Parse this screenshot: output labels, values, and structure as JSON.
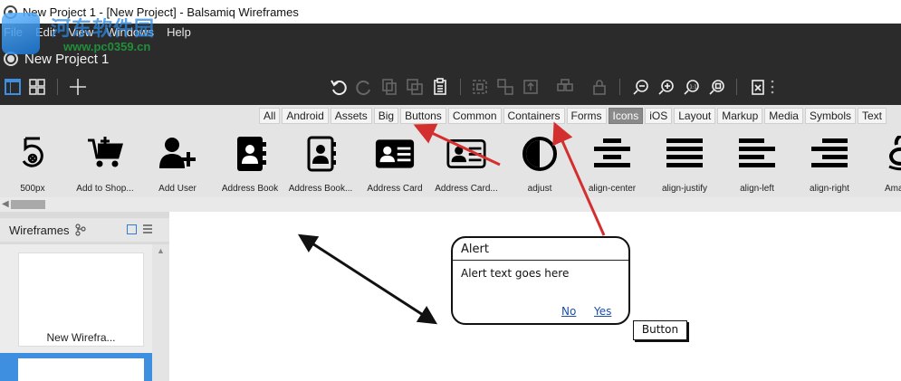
{
  "window": {
    "title": "New Project 1 - [New Project] - Balsamiq Wireframes"
  },
  "watermark": {
    "text": "河东软件园",
    "url": "www.pc0359.cn"
  },
  "menubar": {
    "items": [
      "File",
      "Edit",
      "View",
      "Windows",
      "Help"
    ]
  },
  "project": {
    "name": "New Project 1"
  },
  "library": {
    "categories": [
      {
        "label": "All",
        "active": false
      },
      {
        "label": "Android",
        "active": false
      },
      {
        "label": "Assets",
        "active": false
      },
      {
        "label": "Big",
        "active": false
      },
      {
        "label": "Buttons",
        "active": false
      },
      {
        "label": "Common",
        "active": false
      },
      {
        "label": "Containers",
        "active": false
      },
      {
        "label": "Forms",
        "active": false
      },
      {
        "label": "Icons",
        "active": true
      },
      {
        "label": "iOS",
        "active": false
      },
      {
        "label": "Layout",
        "active": false
      },
      {
        "label": "Markup",
        "active": false
      },
      {
        "label": "Media",
        "active": false
      },
      {
        "label": "Symbols",
        "active": false
      },
      {
        "label": "Text",
        "active": false
      }
    ],
    "icons": [
      {
        "label": "500px",
        "icon": "500px-icon"
      },
      {
        "label": "Add to Shop...",
        "icon": "add-to-shopping-cart-icon"
      },
      {
        "label": "Add User",
        "icon": "add-user-icon"
      },
      {
        "label": "Address Book",
        "icon": "address-book-icon"
      },
      {
        "label": "Address Book...",
        "icon": "address-book-outline-icon"
      },
      {
        "label": "Address Card",
        "icon": "address-card-icon"
      },
      {
        "label": "Address Card...",
        "icon": "address-card-outline-icon"
      },
      {
        "label": "adjust",
        "icon": "adjust-icon"
      },
      {
        "label": "align-center",
        "icon": "align-center-icon"
      },
      {
        "label": "align-justify",
        "icon": "align-justify-icon"
      },
      {
        "label": "align-left",
        "icon": "align-left-icon"
      },
      {
        "label": "align-right",
        "icon": "align-right-icon"
      },
      {
        "label": "Ama",
        "icon": "amazon-icon"
      }
    ]
  },
  "left_panel": {
    "title": "Wireframes",
    "thumb_label": "New Wirefra..."
  },
  "canvas": {
    "alert": {
      "title": "Alert",
      "text": "Alert text goes here",
      "no": "No",
      "yes": "Yes"
    },
    "button_label": "Button"
  },
  "colors": {
    "dark_bar": "#2b2b2b",
    "library_bg": "#e4e4e4",
    "active_category": "#8a8a8a",
    "annotation_arrow": "#d32f2f",
    "selection_blue": "#3f8fe0"
  }
}
